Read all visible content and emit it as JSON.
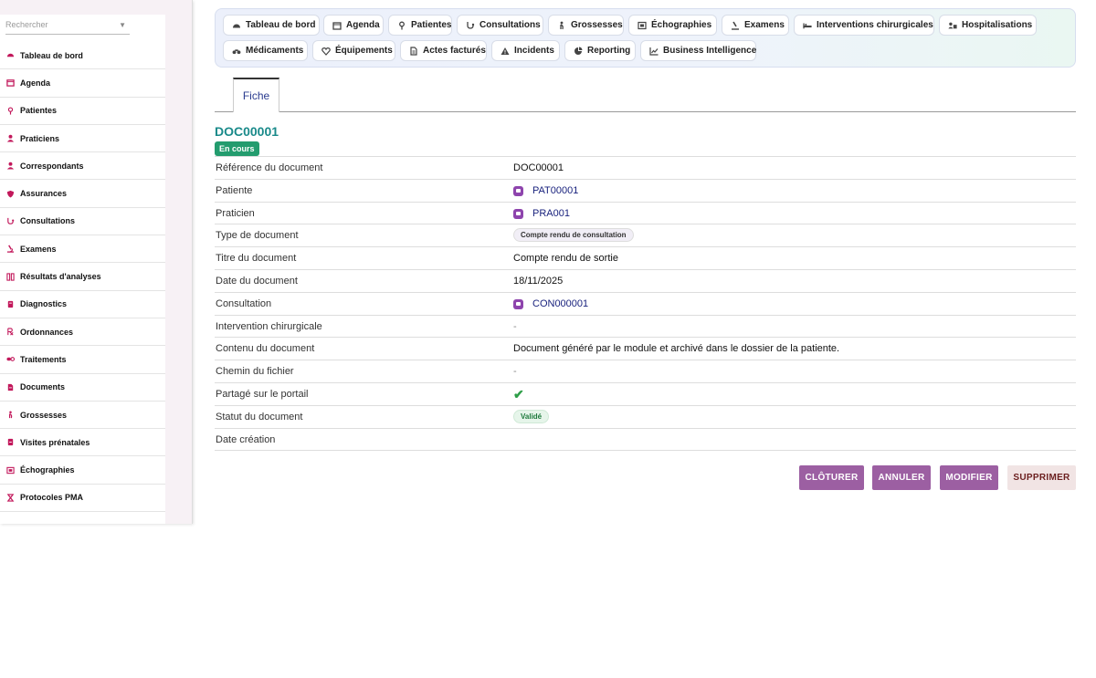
{
  "sidebar": {
    "search_placeholder": "Rechercher",
    "items": [
      {
        "label": "Tableau de bord",
        "icon": "dashboard-icon"
      },
      {
        "label": "Agenda",
        "icon": "calendar-icon"
      },
      {
        "label": "Patientes",
        "icon": "female-icon"
      },
      {
        "label": "Praticiens",
        "icon": "doctor-icon"
      },
      {
        "label": "Correspondants",
        "icon": "user-icon"
      },
      {
        "label": "Assurances",
        "icon": "shield-icon"
      },
      {
        "label": "Consultations",
        "icon": "stethoscope-icon"
      },
      {
        "label": "Examens",
        "icon": "microscope-icon"
      },
      {
        "label": "Résultats d'analyses",
        "icon": "lab-results-icon"
      },
      {
        "label": "Diagnostics",
        "icon": "diagnostics-icon"
      },
      {
        "label": "Ordonnances",
        "icon": "prescription-icon"
      },
      {
        "label": "Traitements",
        "icon": "pills-icon"
      },
      {
        "label": "Documents",
        "icon": "document-icon"
      },
      {
        "label": "Grossesses",
        "icon": "pregnancy-icon"
      },
      {
        "label": "Visites prénatales",
        "icon": "prenatal-visit-icon"
      },
      {
        "label": "Échographies",
        "icon": "ultrasound-icon"
      },
      {
        "label": "Protocoles PMA",
        "icon": "hourglass-icon"
      }
    ]
  },
  "topnav": {
    "row1": [
      {
        "label": "Tableau de bord",
        "icon": "dashboard-icon"
      },
      {
        "label": "Agenda",
        "icon": "calendar-icon"
      },
      {
        "label": "Patientes",
        "icon": "female-icon"
      },
      {
        "label": "Consultations",
        "icon": "stethoscope-icon"
      },
      {
        "label": "Grossesses",
        "icon": "pregnancy-icon"
      },
      {
        "label": "Échographies",
        "icon": "ultrasound-icon"
      },
      {
        "label": "Examens",
        "icon": "microscope-icon"
      },
      {
        "label": "Interventions chirurgicales",
        "icon": "bed-icon"
      },
      {
        "label": "Hospitalisations",
        "icon": "hospital-users-icon"
      }
    ],
    "row2": [
      {
        "label": "Médicaments",
        "icon": "binoculars-icon"
      },
      {
        "label": "Équipements",
        "icon": "heart-icon"
      },
      {
        "label": "Actes facturés",
        "icon": "invoice-icon"
      },
      {
        "label": "Incidents",
        "icon": "warning-icon"
      },
      {
        "label": "Reporting",
        "icon": "pie-chart-icon"
      },
      {
        "label": "Business Intelligence",
        "icon": "line-chart-icon"
      }
    ]
  },
  "tabs": {
    "active": "Fiche"
  },
  "record": {
    "title": "DOC00001",
    "state": "En cours",
    "fields": {
      "reference_label": "Référence du document",
      "reference_value": "DOC00001",
      "patiente_label": "Patiente",
      "patiente_value": "PAT00001",
      "praticien_label": "Praticien",
      "praticien_value": "PRA001",
      "type_label": "Type de document",
      "type_value": "Compte rendu de consultation",
      "titre_label": "Titre du document",
      "titre_value": "Compte rendu de sortie",
      "date_label": "Date du document",
      "date_value": "18/11/2025",
      "consultation_label": "Consultation",
      "consultation_value": "CON000001",
      "intervention_label": "Intervention chirurgicale",
      "intervention_value": "-",
      "contenu_label": "Contenu du document",
      "contenu_value": "Document généré par le module et archivé dans le dossier de la patiente.",
      "chemin_label": "Chemin du fichier",
      "chemin_value": "-",
      "partage_label": "Partagé sur le portail",
      "partage_value": "✔",
      "statut_label": "Statut du document",
      "statut_value": "Validé",
      "creation_label": "Date création"
    }
  },
  "actions": {
    "cloturer": "CLÔTURER",
    "annuler": "ANNULER",
    "modifier": "MODIFIER",
    "supprimer": "SUPPRIMER"
  },
  "colors": {
    "accent": "#9c5fa2",
    "title_teal": "#1a8a8a",
    "status_green": "#239c6e",
    "link_blue": "#1a237e",
    "icon_pink": "#c2185b"
  }
}
